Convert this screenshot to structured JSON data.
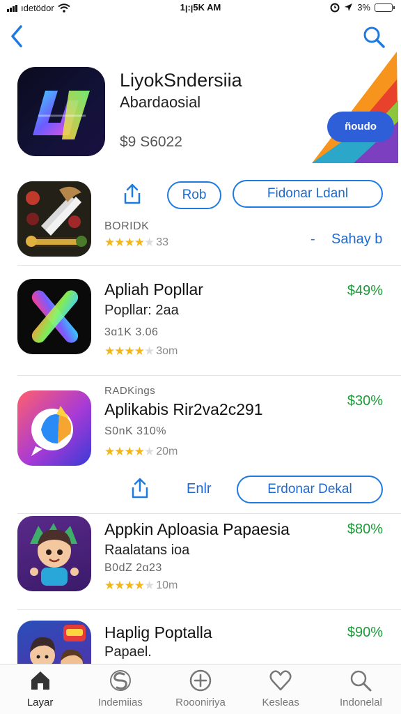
{
  "status_bar": {
    "carrier": "ıdetödor",
    "time": "1ꞁ:ꞁ5K AM",
    "battery": "3%",
    "battery_level": 0.3
  },
  "hero": {
    "title": "LiyokSndersiia",
    "subtitle": "Abardaosial",
    "price": "$9 S6022",
    "banner_text": "ñoudo"
  },
  "featured_app": {
    "meta": "BORIDK",
    "rating_count": "33",
    "link_dash": "-",
    "link_label": "Sahay b",
    "rating": 4,
    "actions": {
      "secondary_label": "Rob",
      "primary_label": "Fidonar Ldanl"
    }
  },
  "apps": [
    {
      "title": "Apliah Popllar",
      "subtitle": "Popllar: 2aa",
      "meta": "3ɑ1K 3.06",
      "rating_count": "3om",
      "price": "$49%",
      "rating": 4
    },
    {
      "category": "RADKings",
      "title": "Aplikabis Rir2va2c291",
      "meta": "S0nK 310%",
      "rating_count": "20m",
      "price": "$30%",
      "rating": 4
    },
    {
      "title": "Appkin Aploasia Papaesia",
      "subtitle": "Raalatans ioa",
      "meta": "B0dZ 2ɑ23",
      "rating_count": "10m",
      "price": "$80%",
      "rating": 4
    },
    {
      "title": "Haplig Poptalla",
      "subtitle": "Papael.",
      "price": "$90%"
    }
  ],
  "mid_actions": {
    "link_label": "Enlr",
    "primary_label": "Erdonar Dekal"
  },
  "tabs": [
    {
      "label": "Layar",
      "icon": "home-icon",
      "active": true
    },
    {
      "label": "Indemiias",
      "icon": "apps-icon",
      "active": false
    },
    {
      "label": "Roooniriya",
      "icon": "add-icon",
      "active": false
    },
    {
      "label": "Kesleas",
      "icon": "heart-icon",
      "active": false
    },
    {
      "label": "Indonelal",
      "icon": "search-icon",
      "active": false
    }
  ],
  "colors": {
    "accent": "#1f7ae0",
    "price_green": "#1e9a3a",
    "star": "#f3b614",
    "battery": "#f2a20c"
  }
}
